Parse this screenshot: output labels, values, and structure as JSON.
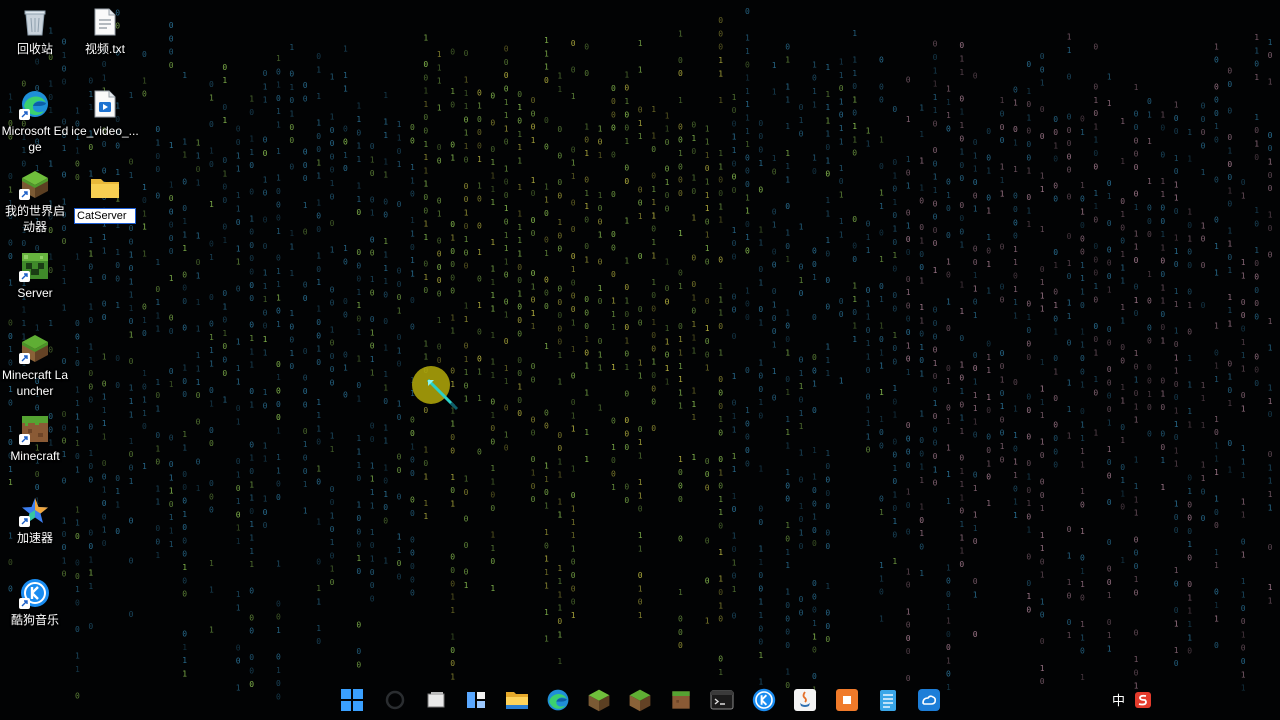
{
  "desktop": {
    "icons": [
      {
        "label": "回收站",
        "icon": "recycle-bin-icon"
      },
      {
        "label": "视频.txt",
        "icon": "text-file-icon"
      },
      {
        "label": "Microsoft Edge",
        "icon": "edge-icon"
      },
      {
        "label": "ice_video_...",
        "icon": "video-file-icon"
      },
      {
        "label": "我的世界启动器",
        "icon": "minecraft-launcher-cn-icon"
      },
      {
        "label": "Server",
        "icon": "minecraft-server-icon"
      },
      {
        "label": "Minecraft Launcher",
        "icon": "minecraft-grass-block-icon"
      },
      {
        "label": "Minecraft",
        "icon": "minecraft-dirt-block-icon"
      },
      {
        "label": "加速器",
        "icon": "accelerator-icon"
      },
      {
        "label": "酷狗音乐",
        "icon": "kugou-music-icon"
      }
    ],
    "rename_field": {
      "value": "CatServer",
      "icon": "folder-icon"
    }
  },
  "taskbar": {
    "items": [
      {
        "icon": "windows-start-icon"
      },
      {
        "icon": "search-icon"
      },
      {
        "icon": "task-view-icon"
      },
      {
        "icon": "widgets-icon"
      },
      {
        "icon": "file-explorer-icon"
      },
      {
        "icon": "edge-icon"
      },
      {
        "icon": "minecraft-launcher-icon"
      },
      {
        "icon": "minecraft-grass-block-icon"
      },
      {
        "icon": "minecraft-dirt-block-icon"
      },
      {
        "icon": "terminal-icon"
      },
      {
        "icon": "kugou-music-icon"
      },
      {
        "icon": "java-icon"
      },
      {
        "icon": "orange-app-icon"
      },
      {
        "icon": "notepad-icon"
      },
      {
        "icon": "cloud-sync-icon"
      }
    ],
    "tray": {
      "ime_label": "中",
      "tray_icon": "red-s-app-icon"
    }
  },
  "colors": {
    "matrix_blue": "#2f7fa8",
    "matrix_green": "#9ad65a",
    "matrix_yellow": "#d6d24a",
    "matrix_pink": "#b88aa0",
    "cursor_highlight": "#b4aa0a"
  }
}
